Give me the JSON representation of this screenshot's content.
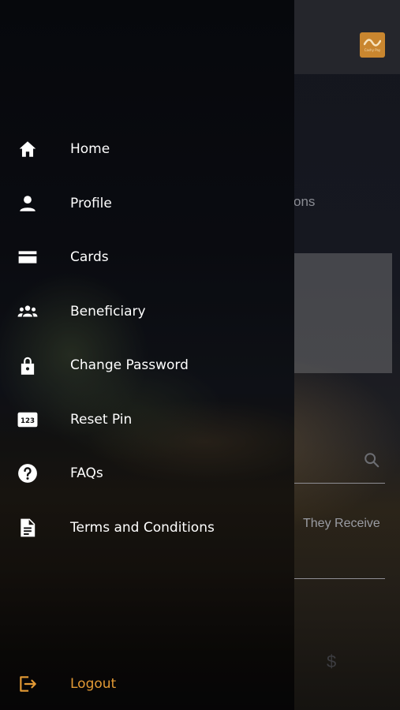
{
  "background_app": {
    "partial_heading": "ons",
    "they_receive_label": "They Receive",
    "currency_symbol": "$",
    "logo_text": "Cashy Pay",
    "accent_color": "#c9862f"
  },
  "drawer": {
    "menu": [
      {
        "label": "Home",
        "icon": "home-icon"
      },
      {
        "label": "Profile",
        "icon": "person-icon"
      },
      {
        "label": "Cards",
        "icon": "card-icon"
      },
      {
        "label": "Beneficiary",
        "icon": "group-icon"
      },
      {
        "label": "Change Password",
        "icon": "lock-icon"
      },
      {
        "label": "Reset Pin",
        "icon": "pin-123-icon"
      },
      {
        "label": "FAQs",
        "icon": "help-icon"
      },
      {
        "label": "Terms and Conditions",
        "icon": "document-icon"
      }
    ],
    "logout": {
      "label": "Logout",
      "icon": "logout-icon",
      "color": "#e39a35"
    }
  }
}
